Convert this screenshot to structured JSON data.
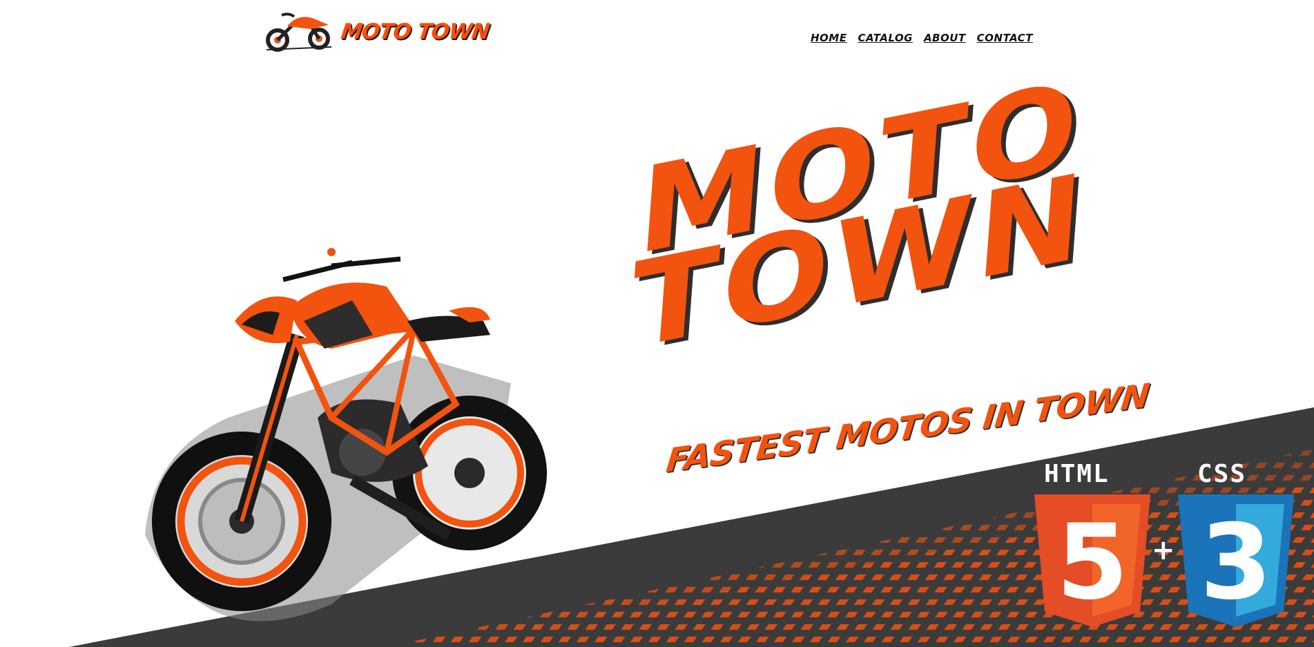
{
  "brand": {
    "logo_text": "MOTO TOWN"
  },
  "nav": [
    {
      "label": "HOME"
    },
    {
      "label": "CATALOG"
    },
    {
      "label": "ABOUT"
    },
    {
      "label": "CONTACT"
    }
  ],
  "hero": {
    "title_line1": "MOTO",
    "title_line2": "TOWN",
    "tagline": "FASTEST MOTOS IN TOWN"
  },
  "tech": {
    "html_label": "HTML",
    "html_badge": "5",
    "css_label": "CSS",
    "css_badge": "3",
    "plus": "+"
  },
  "colors": {
    "accent": "#f2530f",
    "ground": "#3b3b3b",
    "html5_orange": "#e44d26",
    "css3_blue": "#1b73ba"
  },
  "icons": {
    "logo": "motorcycle-logo-icon",
    "html5": "html5-shield-icon",
    "css3": "css3-shield-icon"
  }
}
